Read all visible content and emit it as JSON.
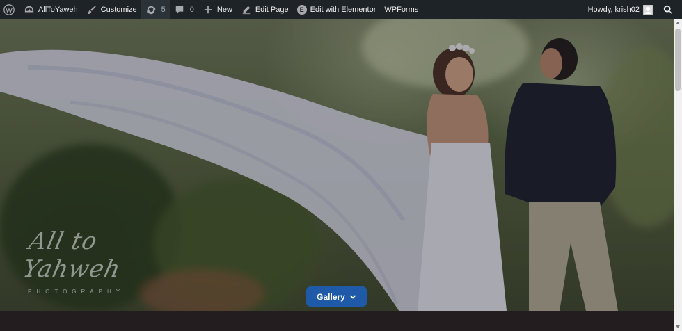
{
  "adminbar": {
    "site_name": "AllToYaweh",
    "customize": "Customize",
    "updates_count": "5",
    "comments_count": "0",
    "new": "New",
    "edit_page": "Edit Page",
    "edit_elementor": "Edit with Elementor",
    "wpforms": "WPForms",
    "howdy": "Howdy, krish02"
  },
  "hero": {
    "logo_script": "All to Yahweh",
    "logo_sub": "PHOTOGRAPHY",
    "button_label": "Gallery",
    "button_color": "#1e5aa8"
  },
  "icons": {
    "wordpress": "wordpress-icon",
    "dashboard": "dashboard-icon",
    "brush": "brush-icon",
    "updates": "refresh-icon",
    "comments": "comment-icon",
    "new": "plus-icon",
    "edit": "pencil-icon",
    "elementor": "elementor-icon",
    "search": "search-icon",
    "chevron": "chevron-down-icon"
  }
}
